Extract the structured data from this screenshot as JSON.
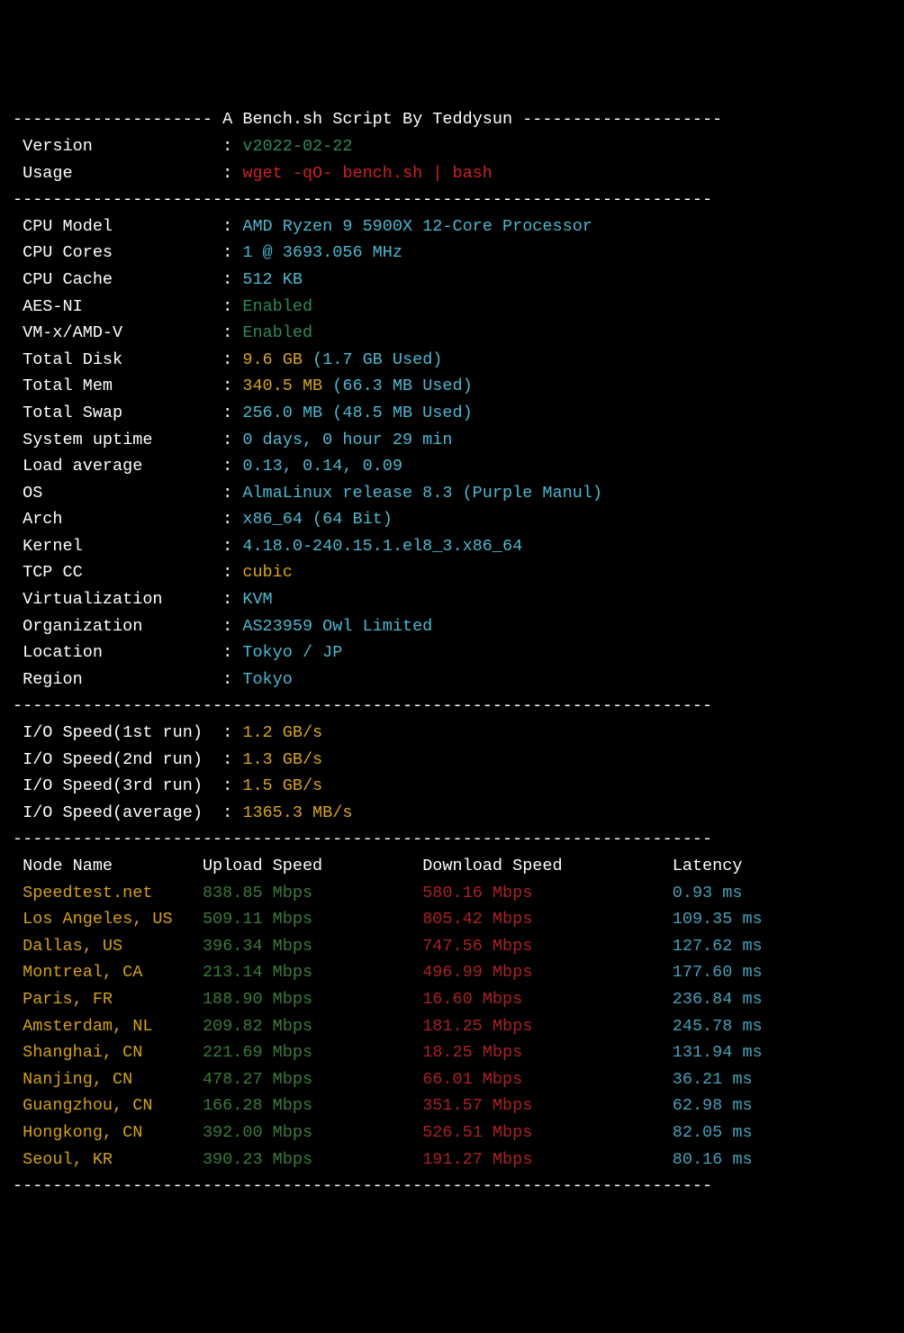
{
  "header": {
    "title_prefix": "-------------------- ",
    "title": "A Bench.sh Script By Teddysun",
    "title_suffix": " --------------------"
  },
  "meta": {
    "version_label": " Version",
    "version_value": "v2022-02-22",
    "usage_label": " Usage",
    "usage_value": "wget -qO- bench.sh | bash"
  },
  "divider": "----------------------------------------------------------------------",
  "sysinfo": [
    {
      "label": " CPU Model",
      "value": "AMD Ryzen 9 5900X 12-Core Processor",
      "color": "cyan"
    },
    {
      "label": " CPU Cores",
      "value": "1 @ 3693.056 MHz",
      "color": "cyan"
    },
    {
      "label": " CPU Cache",
      "value": "512 KB",
      "color": "cyan"
    },
    {
      "label": " AES-NI",
      "value": "Enabled",
      "color": "green"
    },
    {
      "label": " VM-x/AMD-V",
      "value": "Enabled",
      "color": "green"
    }
  ],
  "disk": {
    "label": " Total Disk",
    "value1": "9.6 GB",
    "value2": " (1.7 GB Used)"
  },
  "mem": {
    "label": " Total Mem",
    "value1": "340.5 MB",
    "value2": " (66.3 MB Used)"
  },
  "swap": {
    "label": " Total Swap",
    "value": "256.0 MB (48.5 MB Used)"
  },
  "sysinfo2": [
    {
      "label": " System uptime",
      "value": "0 days, 0 hour 29 min",
      "color": "cyan"
    },
    {
      "label": " Load average",
      "value": "0.13, 0.14, 0.09",
      "color": "cyan"
    },
    {
      "label": " OS",
      "value": "AlmaLinux release 8.3 (Purple Manul)",
      "color": "cyan"
    },
    {
      "label": " Arch",
      "value": "x86_64 (64 Bit)",
      "color": "cyan"
    },
    {
      "label": " Kernel",
      "value": "4.18.0-240.15.1.el8_3.x86_64",
      "color": "cyan"
    },
    {
      "label": " TCP CC",
      "value": "cubic",
      "color": "yellow"
    },
    {
      "label": " Virtualization",
      "value": "KVM",
      "color": "cyan"
    },
    {
      "label": " Organization",
      "value": "AS23959 Owl Limited",
      "color": "cyan"
    },
    {
      "label": " Location",
      "value": "Tokyo / JP",
      "color": "cyan"
    },
    {
      "label": " Region",
      "value": "Tokyo",
      "color": "cyan"
    }
  ],
  "io": [
    {
      "label": " I/O Speed(1st run) ",
      "value": "1.2 GB/s"
    },
    {
      "label": " I/O Speed(2nd run) ",
      "value": "1.3 GB/s"
    },
    {
      "label": " I/O Speed(3rd run) ",
      "value": "1.5 GB/s"
    },
    {
      "label": " I/O Speed(average) ",
      "value": "1365.3 MB/s"
    }
  ],
  "speed_header": {
    "node": " Node Name",
    "up": "Upload Speed",
    "down": "Download Speed",
    "lat": "Latency"
  },
  "speed": [
    {
      "node": " Speedtest.net",
      "up": "838.85 Mbps",
      "down": "580.16 Mbps",
      "lat": "0.93 ms"
    },
    {
      "node": " Los Angeles, US",
      "up": "509.11 Mbps",
      "down": "805.42 Mbps",
      "lat": "109.35 ms"
    },
    {
      "node": " Dallas, US",
      "up": "396.34 Mbps",
      "down": "747.56 Mbps",
      "lat": "127.62 ms"
    },
    {
      "node": " Montreal, CA",
      "up": "213.14 Mbps",
      "down": "496.99 Mbps",
      "lat": "177.60 ms"
    },
    {
      "node": " Paris, FR",
      "up": "188.90 Mbps",
      "down": "16.60 Mbps",
      "lat": "236.84 ms"
    },
    {
      "node": " Amsterdam, NL",
      "up": "209.82 Mbps",
      "down": "181.25 Mbps",
      "lat": "245.78 ms"
    },
    {
      "node": " Shanghai, CN",
      "up": "221.69 Mbps",
      "down": "18.25 Mbps",
      "lat": "131.94 ms"
    },
    {
      "node": " Nanjing, CN",
      "up": "478.27 Mbps",
      "down": "66.01 Mbps",
      "lat": "36.21 ms"
    },
    {
      "node": " Guangzhou, CN",
      "up": "166.28 Mbps",
      "down": "351.57 Mbps",
      "lat": "62.98 ms"
    },
    {
      "node": " Hongkong, CN",
      "up": "392.00 Mbps",
      "down": "526.51 Mbps",
      "lat": "82.05 ms"
    },
    {
      "node": " Seoul, KR",
      "up": "390.23 Mbps",
      "down": "191.27 Mbps",
      "lat": "80.16 ms"
    }
  ]
}
